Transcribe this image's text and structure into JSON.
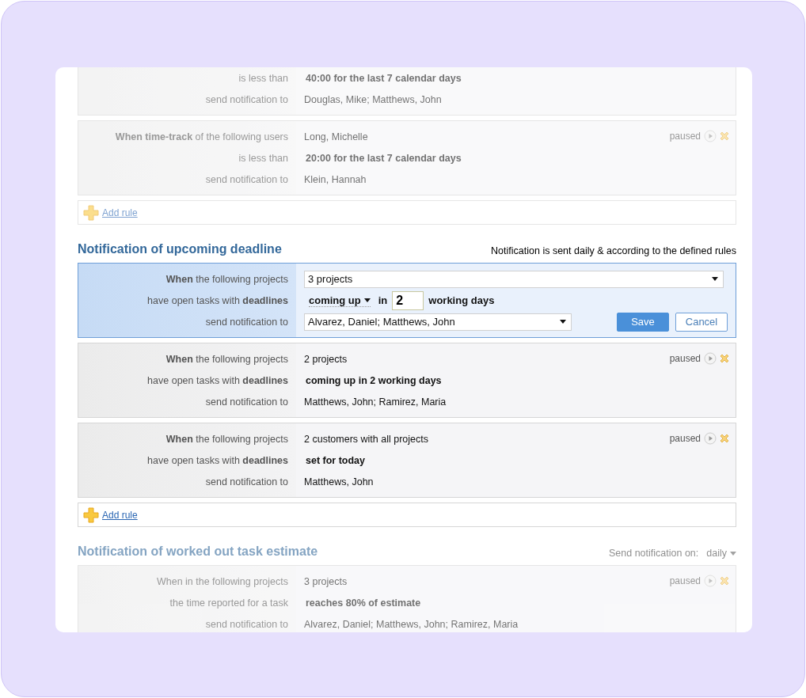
{
  "sections": [
    {
      "dimmed": true,
      "rules": [
        {
          "kind": "view",
          "selected": false,
          "rows": [
            {
              "label": "is less than",
              "value": "40:00 for the last 7 calendar days",
              "bold": true
            },
            {
              "label": "send notification to",
              "value": "Douglas, Mike; Matthews, John",
              "bold": false
            }
          ]
        },
        {
          "kind": "view",
          "selected": false,
          "paused": true,
          "status": "paused",
          "rows": [
            {
              "label": "**When time-track** of the following users",
              "value": "Long, Michelle",
              "bold": false
            },
            {
              "label": "is less than",
              "value": "20:00 for the last 7 calendar days",
              "bold": true
            },
            {
              "label": "send notification to",
              "value": "Klein, Hannah",
              "bold": false
            }
          ]
        }
      ],
      "add_rule": "Add rule"
    },
    {
      "dimmed": false,
      "title": "Notification of upcoming deadline",
      "note": "Notification is sent daily & according to the defined rules",
      "rules": [
        {
          "kind": "edit",
          "selected": true,
          "rows": [
            {
              "label": "**When** the following projects",
              "control": {
                "kind": "select",
                "value": "3 projects",
                "wide": true
              }
            },
            {
              "label": "have open tasks with **deadlines**",
              "control": {
                "kind": "deadline",
                "mode": "coming up",
                "joiner": "in",
                "days": "2",
                "unit": "working days"
              }
            },
            {
              "label": "send notification to",
              "control": {
                "kind": "select",
                "value": "Alvarez, Daniel; Matthews, John",
                "wide": false
              },
              "actions": [
                "Save",
                "Cancel"
              ]
            }
          ]
        },
        {
          "kind": "view",
          "selected": false,
          "paused": true,
          "status": "paused",
          "rows": [
            {
              "label": "**When** the following projects",
              "value": "2 projects",
              "bold": false
            },
            {
              "label": "have open tasks with **deadlines**",
              "value": "coming up in 2 working days",
              "bold": true
            },
            {
              "label": "send notification to",
              "value": "Matthews, John; Ramirez, Maria",
              "bold": false
            }
          ]
        },
        {
          "kind": "view",
          "selected": false,
          "paused": true,
          "status": "paused",
          "rows": [
            {
              "label": "**When** the following projects",
              "value": "2 customers with all projects",
              "bold": false
            },
            {
              "label": "have open tasks with **deadlines**",
              "value": "set for today",
              "bold": true
            },
            {
              "label": "send notification to",
              "value": "Matthews, John",
              "bold": false
            }
          ]
        }
      ],
      "add_rule": "Add rule"
    },
    {
      "dimmed": true,
      "title": "Notification of worked out task estimate",
      "schedule": {
        "label": "Send notification on:",
        "value": "daily"
      },
      "rules": [
        {
          "kind": "view",
          "selected": false,
          "paused": true,
          "status": "paused",
          "rows": [
            {
              "label": "When in the following projects",
              "value": "3 projects",
              "bold": false
            },
            {
              "label": "the time reported for a task",
              "value": "reaches 80% of estimate",
              "bold": true
            },
            {
              "label": "send notification to",
              "value": "Alvarez, Daniel; Matthews, John; Ramirez, Maria",
              "bold": false
            }
          ]
        }
      ]
    }
  ]
}
